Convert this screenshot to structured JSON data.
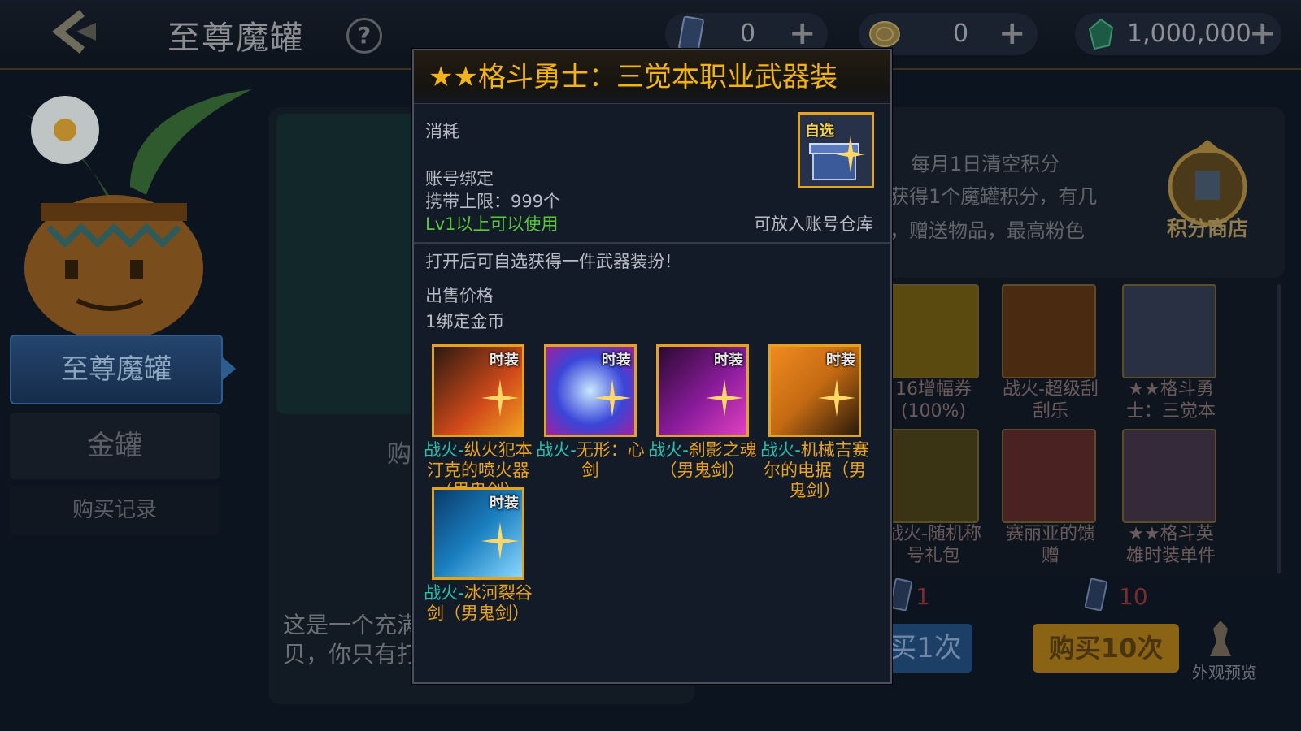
{
  "header": {
    "title": "至尊魔罐",
    "help_label": "?",
    "currencies": [
      {
        "icon": "ticket-icon",
        "value": "0",
        "plus": "+"
      },
      {
        "icon": "gold-coin-icon",
        "value": "0",
        "plus": "+"
      },
      {
        "icon": "green-gem-icon",
        "value": "1,000,000",
        "plus": "+"
      }
    ]
  },
  "sidebar": {
    "items": [
      {
        "label": "至尊魔罐",
        "active": true
      },
      {
        "label": "金罐",
        "active": false
      },
      {
        "label": "购买记录",
        "active": false
      }
    ]
  },
  "center": {
    "buy_text": "购",
    "description": "这是一个充满 带来好运气， 样的宝贝，你只有打开它才知道！"
  },
  "right": {
    "notice_lines": [
      "每月1日清空积分",
      "获得1个魔罐积分，有几",
      "，赠送物品，最高粉色"
    ],
    "shop_label": "积分商店",
    "grid_items": [
      {
        "label": "16增幅券(100%)"
      },
      {
        "label": "战火-超级刮刮乐"
      },
      {
        "label": "★★格斗勇士：三觉本"
      },
      {
        "label": "战火-随机称号礼包"
      },
      {
        "label": "赛丽亚的馈赠"
      },
      {
        "label": "★★格斗英雄时装单件"
      }
    ],
    "cost_single": "1",
    "cost_ten": "10",
    "buy_once": "买1次",
    "buy_ten": "购买10次",
    "preview_label": "外观预览"
  },
  "popup": {
    "title": "★★格斗勇士：三觉本职业武器装",
    "consume": "消耗",
    "account_bound": "账号绑定",
    "carry_limit": "携带上限：999个",
    "level_req": "Lv1以上可以使用",
    "warehouse": "可放入账号仓库",
    "item_badge": "自选",
    "desc": "打开后可自选获得一件武器装扮！",
    "price_label": "出售价格",
    "price_value": "1绑定金币",
    "rewards": [
      {
        "tag": "时装",
        "prefix": "战火-",
        "name": "纵火犯本汀克的喷火器（男鬼剑）",
        "color": "#d14a1a"
      },
      {
        "tag": "时装",
        "prefix": "战火-",
        "name": "无形：心剑",
        "color": "#3a46d8"
      },
      {
        "tag": "时装",
        "prefix": "战火-",
        "name": "刹影之魂（男鬼剑）",
        "color": "#8a1c9c"
      },
      {
        "tag": "时装",
        "prefix": "战火-",
        "name": "机械吉赛尔的电据（男鬼剑）",
        "color": "#c46a12"
      },
      {
        "tag": "时装",
        "prefix": "战火-",
        "name": "冰河裂谷剑（男鬼剑）",
        "color": "#1a7fc0"
      }
    ]
  },
  "colors": {
    "accent_gold": "#f3b317",
    "green_text": "#58c83a",
    "teal_prefix": "#25c2b0",
    "panel_bg": "#141b28"
  }
}
